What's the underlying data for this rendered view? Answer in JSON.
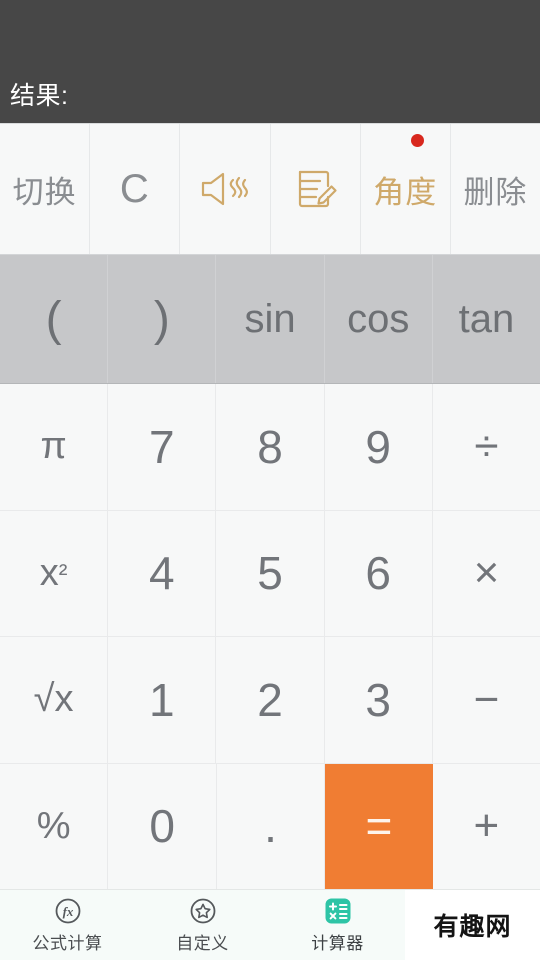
{
  "display": {
    "expression": "",
    "result_label": "结果:"
  },
  "toolbar": {
    "items": [
      {
        "name": "switch",
        "label": "切换",
        "type": "text",
        "style": "gray",
        "badge": false
      },
      {
        "name": "clear",
        "label": "C",
        "type": "text",
        "style": "clear",
        "badge": false
      },
      {
        "name": "sound",
        "label": "",
        "type": "icon",
        "icon": "speaker-sound-icon",
        "style": "accent",
        "badge": false
      },
      {
        "name": "note",
        "label": "",
        "type": "icon",
        "icon": "note-edit-icon",
        "style": "accent",
        "badge": false
      },
      {
        "name": "angle",
        "label": "角度",
        "type": "text",
        "style": "accent",
        "badge": true
      },
      {
        "name": "delete",
        "label": "删除",
        "type": "text",
        "style": "gray",
        "badge": false
      }
    ]
  },
  "trig_row": {
    "keys": [
      {
        "name": "open-paren",
        "label": "("
      },
      {
        "name": "close-paren",
        "label": ")"
      },
      {
        "name": "sin",
        "label": "sin"
      },
      {
        "name": "cos",
        "label": "cos"
      },
      {
        "name": "tan",
        "label": "tan"
      }
    ]
  },
  "keypad": {
    "rows": [
      [
        {
          "name": "pi",
          "label": "π",
          "kind": "fn"
        },
        {
          "name": "seven",
          "label": "7",
          "kind": "digit"
        },
        {
          "name": "eight",
          "label": "8",
          "kind": "digit"
        },
        {
          "name": "nine",
          "label": "9",
          "kind": "digit"
        },
        {
          "name": "divide",
          "label": "÷",
          "kind": "op"
        }
      ],
      [
        {
          "name": "square",
          "label": "x²",
          "kind": "fn"
        },
        {
          "name": "four",
          "label": "4",
          "kind": "digit"
        },
        {
          "name": "five",
          "label": "5",
          "kind": "digit"
        },
        {
          "name": "six",
          "label": "6",
          "kind": "digit"
        },
        {
          "name": "multiply",
          "label": "×",
          "kind": "op"
        }
      ],
      [
        {
          "name": "square-root",
          "label": "√x",
          "kind": "fn"
        },
        {
          "name": "one",
          "label": "1",
          "kind": "digit"
        },
        {
          "name": "two",
          "label": "2",
          "kind": "digit"
        },
        {
          "name": "three",
          "label": "3",
          "kind": "digit"
        },
        {
          "name": "minus",
          "label": "−",
          "kind": "op"
        }
      ],
      [
        {
          "name": "percent",
          "label": "%",
          "kind": "fn"
        },
        {
          "name": "zero",
          "label": "0",
          "kind": "digit"
        },
        {
          "name": "decimal-point",
          "label": ".",
          "kind": "dot"
        },
        {
          "name": "equals",
          "label": "=",
          "kind": "equals"
        },
        {
          "name": "plus",
          "label": "+",
          "kind": "op"
        }
      ]
    ]
  },
  "bottom_nav": {
    "items": [
      {
        "name": "formula-calc",
        "label": "公式计算",
        "icon": "fx-circle-icon",
        "active": false
      },
      {
        "name": "custom",
        "label": "自定义",
        "icon": "star-circle-icon",
        "active": false
      },
      {
        "name": "calculator",
        "label": "计算器",
        "icon": "calculator-icon",
        "active": true
      }
    ],
    "watermark": "有趣网"
  },
  "colors": {
    "display_bg": "#474747",
    "toolbar_bg": "#f7f8f8",
    "trig_bg": "#c6c7c9",
    "key_bg": "#f7f8f8",
    "equals_orange": "#f07d33",
    "accent_tan": "#cfa96a",
    "badge_red": "#d8281e",
    "nav_active_teal": "#2ec4a6",
    "key_text": "#72757a"
  }
}
